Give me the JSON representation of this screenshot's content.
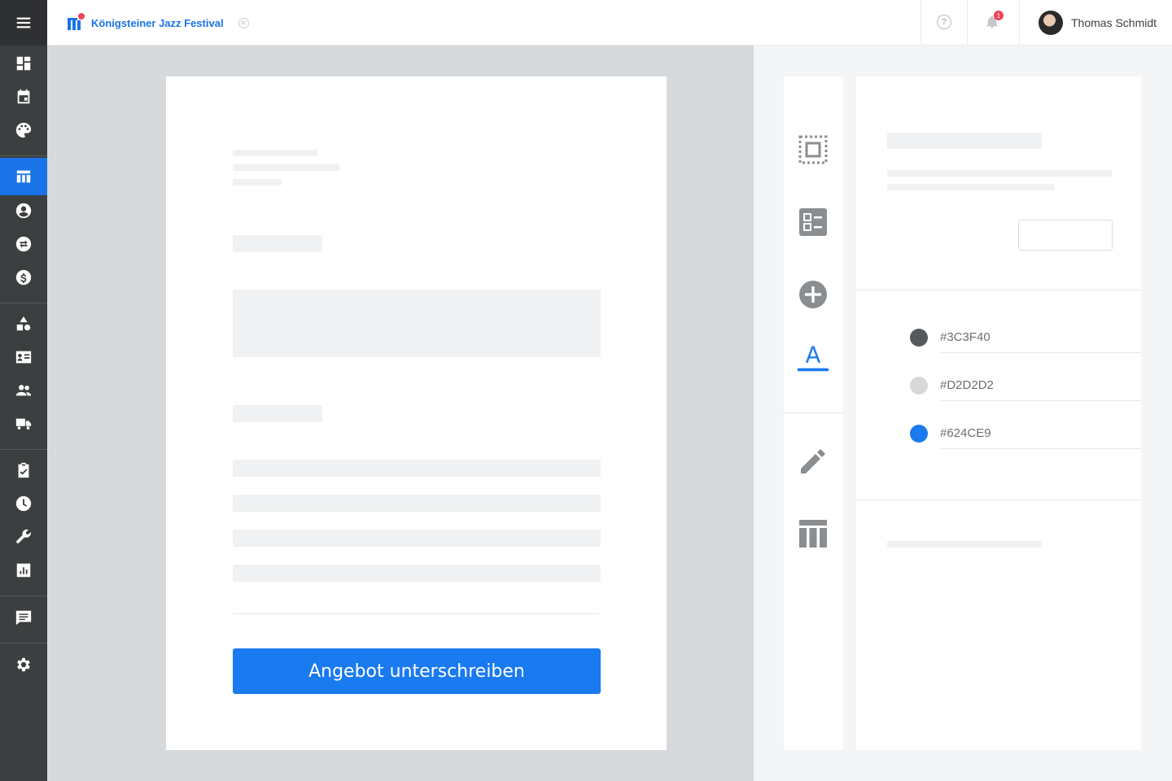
{
  "colors": {
    "sidebar_bg": "#3c3f40",
    "accent": "#1a73e8",
    "notification": "#f0435c"
  },
  "sidebar": {
    "items": [
      {
        "icon": "menu-icon"
      },
      {
        "icon": "dashboard-icon"
      },
      {
        "icon": "calendar-icon"
      },
      {
        "icon": "palette-icon"
      },
      {
        "icon": "table-icon",
        "active": true
      },
      {
        "icon": "user-icon"
      },
      {
        "icon": "swap-icon"
      },
      {
        "icon": "dollar-icon"
      },
      {
        "icon": "shapes-icon"
      },
      {
        "icon": "contact-card-icon"
      },
      {
        "icon": "people-icon"
      },
      {
        "icon": "truck-icon"
      },
      {
        "icon": "clipboard-check-icon"
      },
      {
        "icon": "clock-icon"
      },
      {
        "icon": "wrench-icon"
      },
      {
        "icon": "chart-icon"
      },
      {
        "icon": "message-icon"
      },
      {
        "icon": "settings-icon"
      }
    ]
  },
  "header": {
    "tab_title": "Königsteiner Jazz Festival",
    "notification_count": "1",
    "user_name": "Thomas Schmidt"
  },
  "document": {
    "sign_button_label": "Angebot unterschreiben"
  },
  "toolbar": {
    "tools": [
      "select-area-icon",
      "form-elements-icon",
      "add-circle-icon",
      "text-color-icon",
      "pen-icon",
      "columns-icon"
    ],
    "active_tool": "text-color-icon"
  },
  "panel": {
    "colors": [
      {
        "hex": "#3C3F40",
        "swatch": "#55595c"
      },
      {
        "hex": "#D2D2D2",
        "swatch": "#d8d8d8"
      },
      {
        "hex": "#624CE9",
        "swatch": "#1a7aef"
      }
    ]
  }
}
